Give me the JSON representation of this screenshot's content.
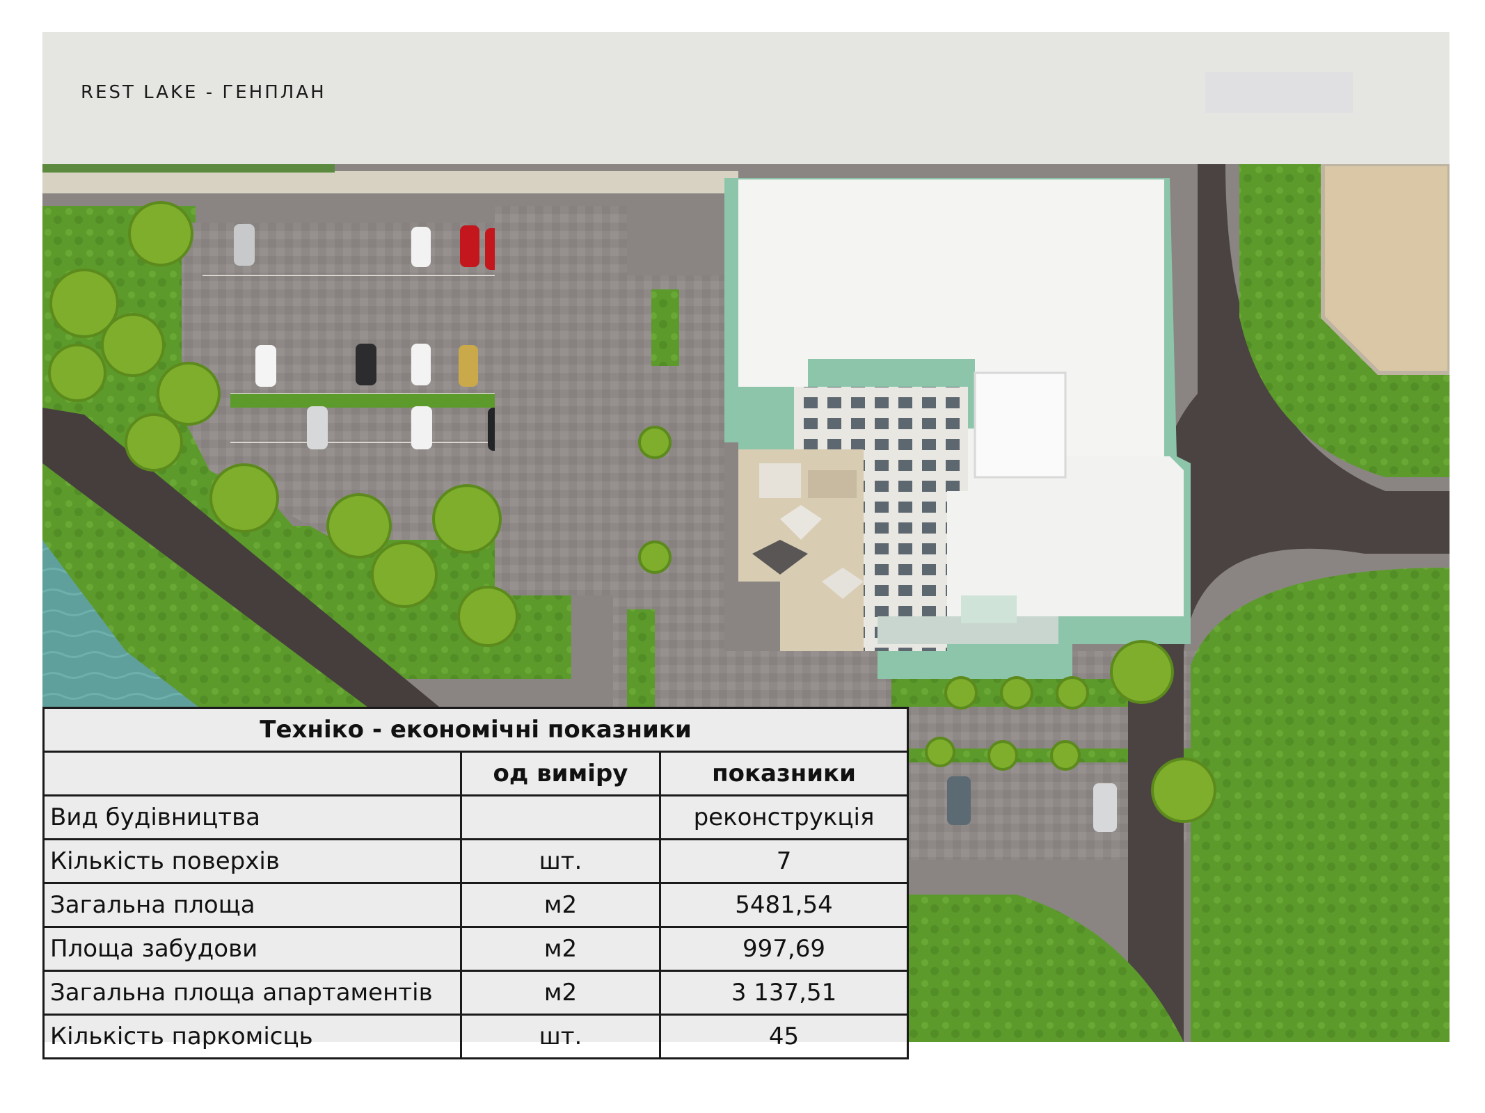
{
  "header": {
    "title": "REST LAKE - ГЕНПЛАН"
  },
  "table": {
    "title": "Техніко - економічні показники",
    "col_unit": "од виміру",
    "col_value": "показники",
    "rows": [
      {
        "label": "Вид будівництва",
        "unit": "",
        "value": "реконструкція"
      },
      {
        "label": "Кількість поверхів",
        "unit": "шт.",
        "value": "7"
      },
      {
        "label": "Загальна площа",
        "unit": "м2",
        "value": "5481,54"
      },
      {
        "label": "Площа забудови",
        "unit": "м2",
        "value": "997,69"
      },
      {
        "label": "Загальна площа апартаментів",
        "unit": "м2",
        "value": "3 137,51"
      },
      {
        "label": "Кількість паркомісць",
        "unit": "шт.",
        "value": "45"
      }
    ]
  },
  "colors": {
    "header_bg": "#e5e5e1",
    "grass": "#5f9a2e",
    "water": "#5e9e9b",
    "road": "#4a4240",
    "paving": "#8d8885",
    "roof": "#f3f3f3",
    "facade_accent": "#8fc6ae"
  }
}
